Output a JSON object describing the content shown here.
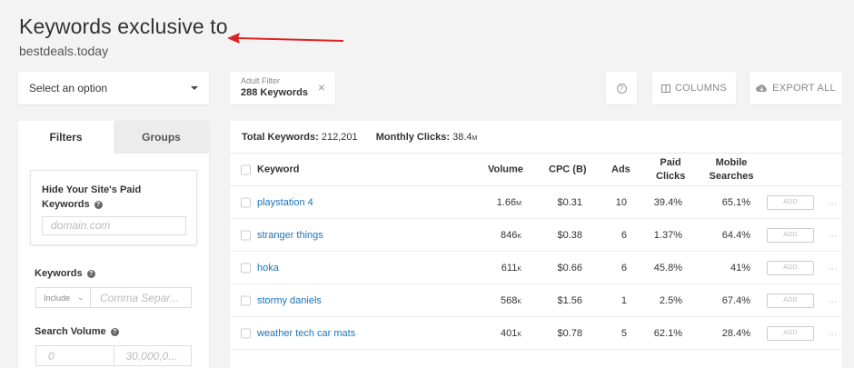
{
  "page": {
    "title": "Keywords exclusive to",
    "domain": "bestdeals.today"
  },
  "select": {
    "value": "Select an option"
  },
  "filter_chip": {
    "label": "Adult Filter",
    "value": "288 Keywords"
  },
  "toolbar": {
    "help": "?",
    "columns_label": "COLUMNS",
    "export_label": "EXPORT ALL"
  },
  "sidebar": {
    "tabs": [
      {
        "label": "Filters"
      },
      {
        "label": "Groups"
      }
    ],
    "hide_paid": {
      "title_line1": "Hide Your Site's Paid",
      "title_line2": "Keywords",
      "placeholder": "domain.com"
    },
    "keywords": {
      "label": "Keywords",
      "include": "Include",
      "placeholder": "Comma Separ..."
    },
    "search_volume": {
      "label": "Search Volume",
      "min_placeholder": "0",
      "max_placeholder": "30,000,0..."
    }
  },
  "summary": {
    "total_label": "Total Keywords:",
    "total_value": "212,201",
    "clicks_label": "Monthly Clicks:",
    "clicks_value": "38.4",
    "clicks_unit": "M"
  },
  "table": {
    "headers": {
      "keyword": "Keyword",
      "volume": "Volume",
      "cpc": "CPC (B)",
      "ads": "Ads",
      "paid_clicks_1": "Paid",
      "paid_clicks_2": "Clicks",
      "mobile_1": "Mobile",
      "mobile_2": "Searches"
    },
    "add_label": "ADD",
    "rows": [
      {
        "keyword": "playstation 4",
        "volume": "1.66",
        "volume_unit": "M",
        "cpc": "$0.31",
        "ads": "10",
        "paid_clicks": "39.4%",
        "mobile": "65.1%"
      },
      {
        "keyword": "stranger things",
        "volume": "846",
        "volume_unit": "K",
        "cpc": "$0.38",
        "ads": "6",
        "paid_clicks": "1.37%",
        "mobile": "64.4%"
      },
      {
        "keyword": "hoka",
        "volume": "611",
        "volume_unit": "K",
        "cpc": "$0.66",
        "ads": "6",
        "paid_clicks": "45.8%",
        "mobile": "41%"
      },
      {
        "keyword": "stormy daniels",
        "volume": "568",
        "volume_unit": "K",
        "cpc": "$1.56",
        "ads": "1",
        "paid_clicks": "2.5%",
        "mobile": "67.4%"
      },
      {
        "keyword": "weather tech car mats",
        "volume": "401",
        "volume_unit": "K",
        "cpc": "$0.78",
        "ads": "5",
        "paid_clicks": "62.1%",
        "mobile": "28.4%"
      }
    ]
  },
  "colors": {
    "link": "#1f73b7",
    "arrow": "#e02020",
    "background": "#f3f3f3"
  }
}
